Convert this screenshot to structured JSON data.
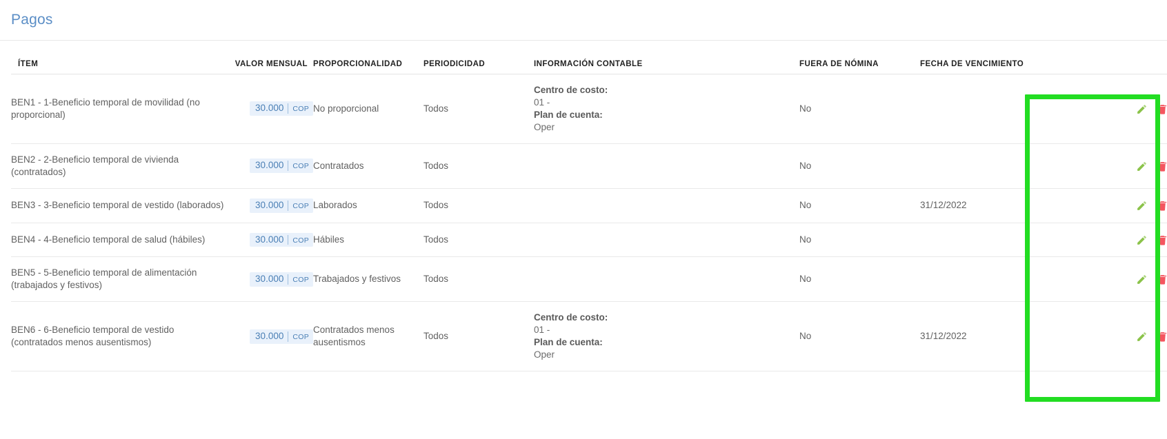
{
  "page": {
    "title": "Pagos"
  },
  "table": {
    "headers": {
      "item": "ÍTEM",
      "valor_mensual": "VALOR MENSUAL",
      "proporcionalidad": "PROPORCIONALIDAD",
      "periodicidad": "PERIODICIDAD",
      "informacion_contable": "INFORMACIÓN CONTABLE",
      "fuera_de_nomina": "FUERA DE NÓMINA",
      "fecha_de_vencimiento": "FECHA DE VENCIMIENTO",
      "acciones": ""
    },
    "labels": {
      "centro_de_costo": "Centro de costo:",
      "plan_de_cuenta": "Plan de cuenta:"
    },
    "rows": [
      {
        "item": "BEN1 - 1-Beneficio temporal de movilidad (no proporcional)",
        "amount": "30.000",
        "currency": "COP",
        "proporcionalidad": "No proporcional",
        "periodicidad": "Todos",
        "centro_de_costo": "01 -",
        "plan_de_cuenta": "Oper",
        "fuera_de_nomina": "No",
        "fecha_de_vencimiento": "",
        "edit_icon": "pencil-icon",
        "delete_icon": "trash-icon"
      },
      {
        "item": "BEN2 - 2-Beneficio temporal de vivienda (contratados)",
        "amount": "30.000",
        "currency": "COP",
        "proporcionalidad": "Contratados",
        "periodicidad": "Todos",
        "centro_de_costo": "",
        "plan_de_cuenta": "",
        "fuera_de_nomina": "No",
        "fecha_de_vencimiento": "",
        "edit_icon": "pencil-icon",
        "delete_icon": "trash-icon"
      },
      {
        "item": "BEN3 - 3-Beneficio temporal de vestido (laborados)",
        "amount": "30.000",
        "currency": "COP",
        "proporcionalidad": "Laborados",
        "periodicidad": "Todos",
        "centro_de_costo": "",
        "plan_de_cuenta": "",
        "fuera_de_nomina": "No",
        "fecha_de_vencimiento": "31/12/2022",
        "edit_icon": "pencil-icon",
        "delete_icon": "trash-icon"
      },
      {
        "item": "BEN4 - 4-Beneficio temporal de salud (hábiles)",
        "amount": "30.000",
        "currency": "COP",
        "proporcionalidad": "Hábiles",
        "periodicidad": "Todos",
        "centro_de_costo": "",
        "plan_de_cuenta": "",
        "fuera_de_nomina": "No",
        "fecha_de_vencimiento": "",
        "edit_icon": "pencil-icon",
        "delete_icon": "trash-icon"
      },
      {
        "item": "BEN5 - 5-Beneficio temporal de alimentación (trabajados y festivos)",
        "amount": "30.000",
        "currency": "COP",
        "proporcionalidad": "Trabajados y festivos",
        "periodicidad": "Todos",
        "centro_de_costo": "",
        "plan_de_cuenta": "",
        "fuera_de_nomina": "No",
        "fecha_de_vencimiento": "",
        "edit_icon": "pencil-icon",
        "delete_icon": "trash-icon"
      },
      {
        "item": "BEN6 - 6-Beneficio temporal de vestido (contratados menos ausentismos)",
        "amount": "30.000",
        "currency": "COP",
        "proporcionalidad": "Contratados menos ausentismos",
        "periodicidad": "Todos",
        "centro_de_costo": "01 -",
        "plan_de_cuenta": "Oper",
        "fuera_de_nomina": "No",
        "fecha_de_vencimiento": "31/12/2022",
        "edit_icon": "pencil-icon",
        "delete_icon": "trash-icon"
      }
    ]
  },
  "annotation": {
    "shape": "rectangle-highlight",
    "color": "#22dd22",
    "target": "actions-column"
  },
  "colors": {
    "title": "#5b8ec6",
    "badge_bg": "#e9f1fb",
    "badge_text": "#4a7fb5",
    "edit_icon": "#8bc34a",
    "delete_icon": "#f4555f",
    "row_border": "#e9e9e9"
  }
}
